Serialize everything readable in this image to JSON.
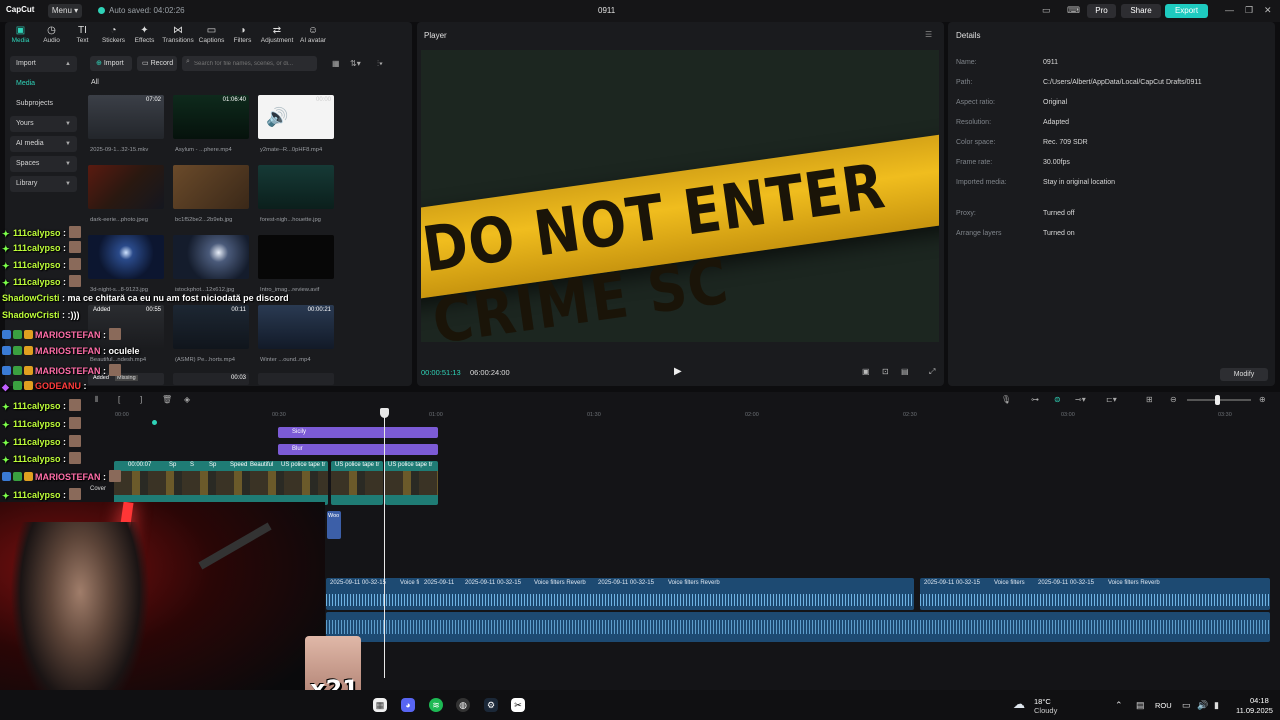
{
  "titlebar": {
    "logo": "CapCut",
    "menu_label": "Menu ▾",
    "autosave": "Auto saved: 04:02:26",
    "project_title": "0911",
    "pro_label": "Pro",
    "share_label": "Share",
    "export_label": "Export",
    "accent": "#1ecbc0"
  },
  "tools": [
    {
      "label": "Media",
      "icon": "▣"
    },
    {
      "label": "Audio",
      "icon": "◷"
    },
    {
      "label": "Text",
      "icon": "TI"
    },
    {
      "label": "Stickers",
      "icon": "◔"
    },
    {
      "label": "Effects",
      "icon": "✦"
    },
    {
      "label": "Transitions",
      "icon": "⋈"
    },
    {
      "label": "Captions",
      "icon": "▭"
    },
    {
      "label": "Filters",
      "icon": "◑"
    },
    {
      "label": "Adjustment",
      "icon": "⇄"
    },
    {
      "label": "AI avatar",
      "icon": "☺"
    }
  ],
  "side_nav": {
    "import": "Import",
    "media": "Media",
    "subprojects": "Subprojects",
    "yours": "Yours",
    "ai_media": "AI media",
    "spaces": "Spaces",
    "library": "Library"
  },
  "media": {
    "import_label": "Import",
    "record_label": "Record",
    "search_placeholder": "Search for file names, scenes, or di...",
    "filter_all": "All",
    "items": [
      {
        "name": "2025-09-1...32-15.mkv",
        "duration": "07:02"
      },
      {
        "name": "Asylum - ...phere.mp4",
        "duration": "01:06:40"
      },
      {
        "name": "y2mate--R...0pHF8.mp4",
        "duration": "00:00"
      },
      {
        "name": "dark-eerie...photo.jpeg",
        "duration": ""
      },
      {
        "name": "bc1f52be2...2b9eb.jpg",
        "duration": ""
      },
      {
        "name": "forest-nigh...houette.jpg",
        "duration": ""
      },
      {
        "name": "3d-night-s...8-9123.jpg",
        "duration": ""
      },
      {
        "name": "istockphot...12x612.jpg",
        "duration": ""
      },
      {
        "name": "Intro_imag...review.avif",
        "duration": ""
      },
      {
        "name": "Beautiful...ndesh.mp4",
        "duration": "00:55",
        "tag": "Added"
      },
      {
        "name": "(ASMR) Pe...horts.mp4",
        "duration": "00:11"
      },
      {
        "name": "Winter ...ound..mp4",
        "duration": "00:00:21"
      },
      {
        "name": "",
        "duration": "",
        "tag": "Added",
        "tag2": "Missing"
      },
      {
        "name": "",
        "duration": "00:03"
      },
      {
        "name": "",
        "duration": ""
      }
    ]
  },
  "player": {
    "title": "Player",
    "tape_text": "DO NOT ENTER CRIME SC",
    "time_current": "00:00:51:13",
    "time_total": "06:00:24:00"
  },
  "details": {
    "title": "Details",
    "rows": [
      {
        "key": "Name:",
        "value": "0911"
      },
      {
        "key": "Path:",
        "value": "C:/Users/Albert/AppData/Local/CapCut Drafts/0911"
      },
      {
        "key": "Aspect ratio:",
        "value": "Original"
      },
      {
        "key": "Resolution:",
        "value": "Adapted"
      },
      {
        "key": "Color space:",
        "value": "Rec. 709 SDR"
      },
      {
        "key": "Frame rate:",
        "value": "30.00fps"
      },
      {
        "key": "Imported media:",
        "value": "Stay in original location"
      },
      {
        "key": "Proxy:",
        "value": "Turned off"
      },
      {
        "key": "Arrange layers",
        "value": "Turned on"
      }
    ],
    "modify_label": "Modify"
  },
  "timeline": {
    "ticks": [
      "00:00",
      "00:30",
      "01:00",
      "01:30",
      "02:00",
      "02:30",
      "03:00",
      "03:30"
    ],
    "effects": [
      {
        "label": "Sicily"
      },
      {
        "label": "Blur"
      }
    ],
    "video_labels": [
      "00:00:07",
      "Sp",
      "S",
      "Sp",
      "Speed",
      "Beautiful",
      "US police tape tr",
      "US police tape tr",
      "US police tape tr"
    ],
    "cover_label": "Cover",
    "text_clip": "Woo",
    "audio_labels": [
      "2025-09-11 00-32-15",
      "Voice fi",
      "2025-09-11",
      "2025-09-11 00-32-15",
      "Voice filters Reverb",
      "2025-09-11 00-32-15",
      "Voice filters Reverb",
      "2025-09-11 00-32-15",
      "Voice filters",
      "2025-09-11 00-32-15",
      "Voice filters Reverb"
    ]
  },
  "chat": [
    {
      "user": "111calypso",
      "msg": "",
      "color": "green"
    },
    {
      "user": "111calypso",
      "msg": "",
      "color": "green"
    },
    {
      "user": "111calypso",
      "msg": "",
      "color": "green"
    },
    {
      "user": "ShadowCristi",
      "msg": "ma ce chitară ca eu nu am fost niciodată pe discord",
      "color": "green"
    },
    {
      "user": "ShadowCristi",
      "msg": ":)))",
      "color": "green"
    },
    {
      "user": "MARIOSTEFAN",
      "msg": "",
      "color": "pink"
    },
    {
      "user": "MARIOSTEFAN",
      "msg": "oculele",
      "color": "pink"
    },
    {
      "user": "MARIOSTEFAN",
      "msg": "",
      "color": "pink"
    },
    {
      "user": "GODEANU",
      "msg": "",
      "color": "red"
    },
    {
      "user": "111calypso",
      "msg": "",
      "color": "green"
    },
    {
      "user": "111calypso",
      "msg": "",
      "color": "green"
    },
    {
      "user": "111calypso",
      "msg": "",
      "color": "green"
    },
    {
      "user": "111calypso",
      "msg": "",
      "color": "green"
    },
    {
      "user": "MARIOSTEFAN",
      "msg": "",
      "color": "pink"
    },
    {
      "user": "111calypso",
      "msg": "",
      "color": "green"
    }
  ],
  "overlay": {
    "multiplier": "x21"
  },
  "taskbar": {
    "temp": "18°C",
    "weather": "Cloudy",
    "lang": "ROU",
    "time": "04:18",
    "date": "11.09.2025"
  }
}
